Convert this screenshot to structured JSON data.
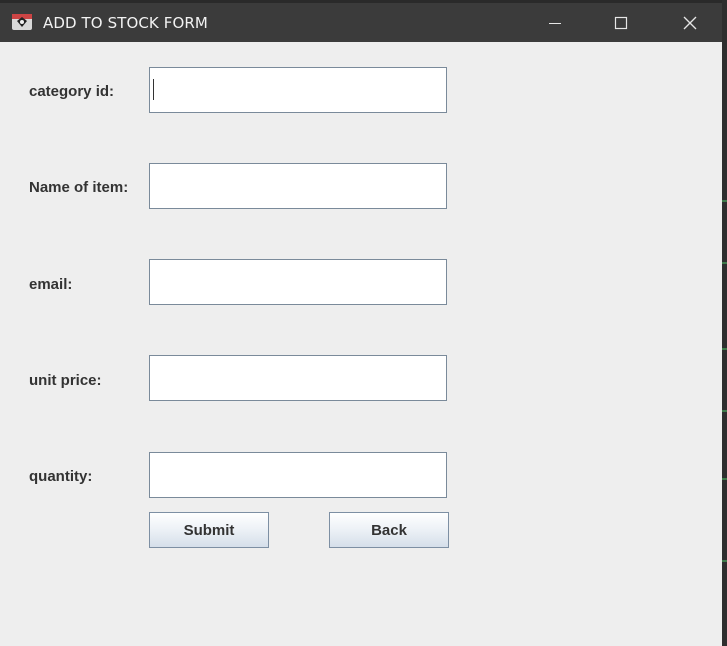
{
  "window": {
    "title": "ADD TO STOCK FORM",
    "controls": {
      "minimize_icon": "minimize-icon",
      "maximize_icon": "maximize-icon",
      "close_icon": "close-icon"
    }
  },
  "form": {
    "fields": [
      {
        "label": "category id:",
        "value": "",
        "focused": true
      },
      {
        "label": " Name of item:",
        "value": ""
      },
      {
        "label": "email:",
        "value": ""
      },
      {
        "label": "unit price:",
        "value": ""
      },
      {
        "label": "quantity:",
        "value": ""
      }
    ],
    "submit_label": "Submit",
    "back_label": "Back"
  },
  "colors": {
    "titlebar": "#3b3b3b",
    "window_bg": "#eeeeee",
    "field_border": "#7a8a9a",
    "label_text": "#333333"
  }
}
